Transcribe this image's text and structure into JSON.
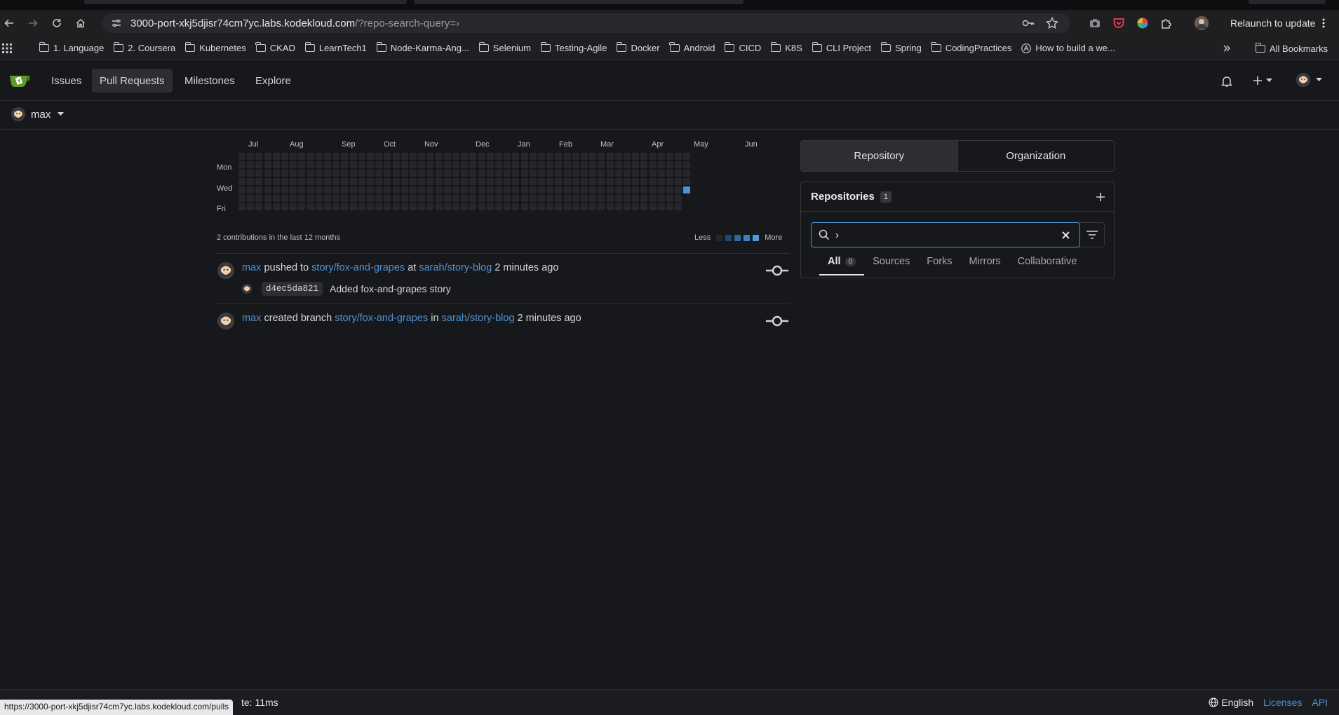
{
  "browser": {
    "url_host": "3000-port-xkj5djisr74cm7yc.labs.kodekloud.com",
    "url_path": "/?repo-search-query=›",
    "relaunch_label": "Relaunch to update",
    "bookmarks": [
      "1. Language",
      "2. Coursera",
      "Kubernetes",
      "CKAD",
      "LearnTech1",
      "Node-Karma-Ang...",
      "Selenium",
      "Testing-Agile",
      "Docker",
      "Android",
      "CICD",
      "K8S",
      "CLI Project",
      "Spring",
      "CodingPractices",
      "How to build a we..."
    ],
    "all_bookmarks_label": "All Bookmarks",
    "status_url": "https://3000-port-xkj5djisr74cm7yc.labs.kodekloud.com/pulls"
  },
  "nav": {
    "issues": "Issues",
    "pull_requests": "Pull Requests",
    "milestones": "Milestones",
    "explore": "Explore"
  },
  "context_user": "max",
  "heatmap": {
    "months": [
      "Jul",
      "Aug",
      "Sep",
      "Oct",
      "Nov",
      "Dec",
      "Jan",
      "Feb",
      "Mar",
      "Apr",
      "May",
      "Jun"
    ],
    "days": [
      "Mon",
      "Wed",
      "Fri"
    ],
    "total_text": "2 contributions in the last 12 months",
    "legend_less": "Less",
    "legend_more": "More",
    "levels": [
      "#25272b",
      "#1f4a73",
      "#2b6aa3",
      "#3b82c4",
      "#4f9be0"
    ],
    "active_color": "#4f92d5"
  },
  "feed": [
    {
      "user": "max",
      "action": "pushed to",
      "ref": "story/fox-and-grapes",
      "prep": "at",
      "repo": "sarah/story-blog",
      "time": "2 minutes ago",
      "commit_sha": "d4ec5da821",
      "commit_msg": "Added fox-and-grapes story"
    },
    {
      "user": "max",
      "action": "created branch",
      "ref": "story/fox-and-grapes",
      "prep": "in",
      "repo": "sarah/story-blog",
      "time": "2 minutes ago"
    }
  ],
  "panel": {
    "tab_repository": "Repository",
    "tab_organization": "Organization",
    "repos_title": "Repositories",
    "repos_count": "1",
    "search_value": "›",
    "subtabs": [
      "All",
      "Sources",
      "Forks",
      "Mirrors",
      "Collaborative"
    ],
    "all_count": "0"
  },
  "footer": {
    "template_time": "te: 11ms",
    "language": "English",
    "licenses": "Licenses",
    "api": "API"
  }
}
